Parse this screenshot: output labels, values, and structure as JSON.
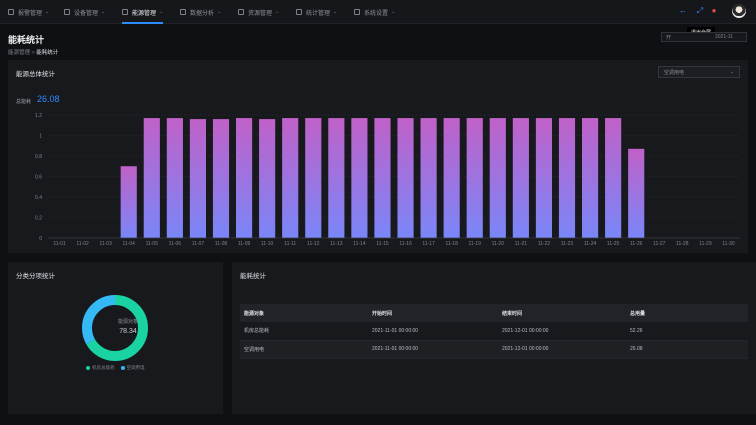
{
  "nav": {
    "items": [
      {
        "label": "报警管理"
      },
      {
        "label": "设备管理"
      },
      {
        "label": "能源管理",
        "active": true
      },
      {
        "label": "数据分析"
      },
      {
        "label": "资源管理"
      },
      {
        "label": "统计管理"
      },
      {
        "label": "系统设置"
      }
    ],
    "tooltip": "退出全屏",
    "icons": [
      "arrow-left-icon",
      "expand-icon",
      "notification-icon"
    ],
    "accent": "#2f8cff"
  },
  "page": {
    "title": "能耗统计",
    "breadcrumb_root": "能源管理",
    "breadcrumb_separator": ">",
    "breadcrumb_current": "能耗统计",
    "date_start": "开",
    "date_end": "2021-11"
  },
  "overview": {
    "title": "能源总体统计",
    "select_value": "空调用电",
    "total_label": "总能耗",
    "total_value": "26.08"
  },
  "chart_data": {
    "type": "bar",
    "categories": [
      "11-01",
      "11-02",
      "11-03",
      "11-04",
      "11-05",
      "11-06",
      "11-07",
      "11-08",
      "11-09",
      "11-10",
      "11-11",
      "11-12",
      "11-13",
      "11-14",
      "11-15",
      "11-16",
      "11-17",
      "11-18",
      "11-19",
      "11-20",
      "11-21",
      "11-22",
      "11-23",
      "11-24",
      "11-25",
      "11-26",
      "11-27",
      "11-28",
      "11-29",
      "11-30"
    ],
    "values": [
      0,
      0,
      0,
      0.7,
      1.17,
      1.17,
      1.16,
      1.16,
      1.17,
      1.16,
      1.17,
      1.17,
      1.17,
      1.17,
      1.17,
      1.17,
      1.17,
      1.17,
      1.17,
      1.17,
      1.17,
      1.17,
      1.17,
      1.17,
      1.17,
      0.87,
      0,
      0,
      0,
      0
    ],
    "yticks": [
      "0",
      "0.2",
      "0.4",
      "0.6",
      "0.8",
      "1",
      "1.2"
    ],
    "ylim": [
      0,
      1.2
    ],
    "grid": true,
    "bar_gradient_top": "#c061c8",
    "bar_gradient_bottom": "#7a86f8"
  },
  "category_panel": {
    "title": "分类分项统计",
    "center_label": "能源对象",
    "center_value": "78.34",
    "segments": [
      {
        "name": "机房总能耗",
        "value": 52.26,
        "color": "#19d3a3"
      },
      {
        "name": "空调用电",
        "value": 26.08,
        "color": "#35b9f5"
      }
    ]
  },
  "stats_panel": {
    "title": "能耗统计",
    "columns": [
      "能源对象",
      "开始时间",
      "结束时间",
      "总用量"
    ],
    "rows": [
      [
        "机房总能耗",
        "2021-11-01 00:00:00",
        "2021-12-01 00:00:00",
        "52.26"
      ],
      [
        "空调用电",
        "2021-11-01 00:00:00",
        "2021-12-01 00:00:00",
        "26.08"
      ]
    ]
  }
}
